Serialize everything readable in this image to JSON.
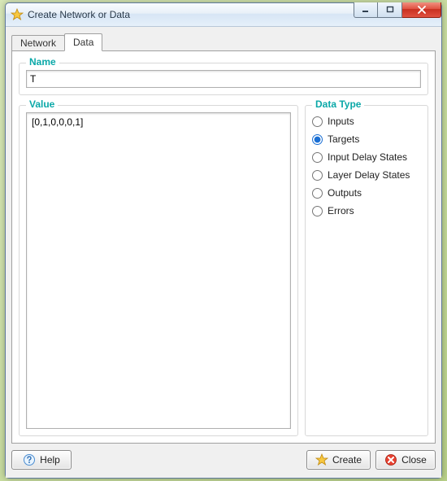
{
  "window": {
    "title": "Create Network or Data"
  },
  "tabs": {
    "network": "Network",
    "data": "Data",
    "active": "data"
  },
  "name": {
    "legend": "Name",
    "value": "T"
  },
  "value": {
    "legend": "Value",
    "text": "[0,1,0,0,0,1]"
  },
  "dataType": {
    "legend": "Data Type",
    "selected": "Targets",
    "options": [
      "Inputs",
      "Targets",
      "Input Delay States",
      "Layer Delay States",
      "Outputs",
      "Errors"
    ]
  },
  "buttons": {
    "help": "Help",
    "create": "Create",
    "close": "Close"
  },
  "colors": {
    "accent": "#0aa8a8",
    "closeRed": "#d13a1f"
  }
}
